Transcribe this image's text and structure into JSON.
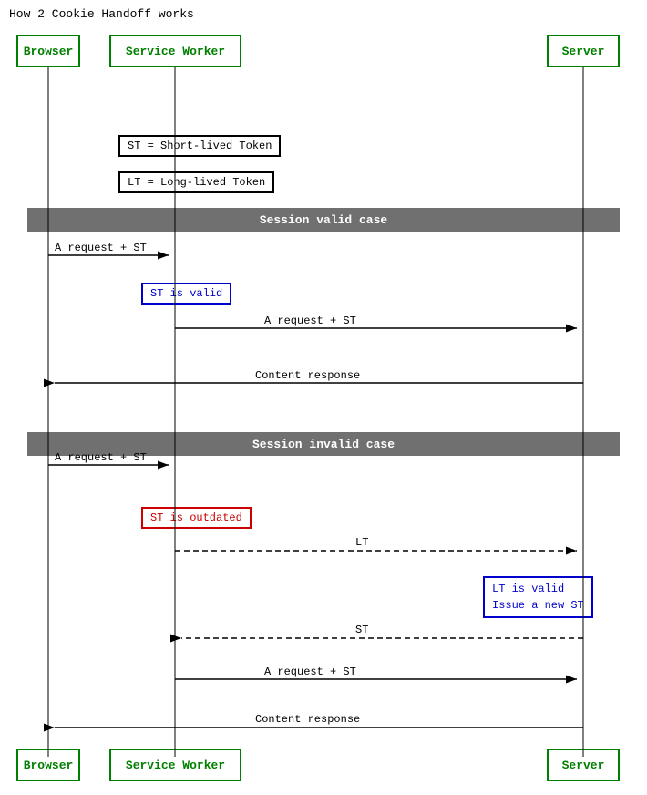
{
  "title": "How 2 Cookie Handoff works",
  "actors": {
    "browser": {
      "label": "Browser",
      "color": "green"
    },
    "serviceWorker": {
      "label": "Service Worker",
      "color": "green"
    },
    "server": {
      "label": "Server",
      "color": "green"
    }
  },
  "sections": {
    "valid": "Session valid case",
    "invalid": "Session invalid case"
  },
  "notes": {
    "st_def": "ST = Short-lived Token",
    "lt_def": "LT = Long-lived Token",
    "st_valid": "ST is valid",
    "st_outdated": "ST is outdated",
    "lt_valid_issue": "LT is valid\nIssue a new ST"
  },
  "messages": {
    "req_st_1": "A request + ST",
    "req_st_2": "A request + ST",
    "content_1": "Content response",
    "req_st_3": "A request + ST",
    "lt_msg": "LT",
    "st_msg": "ST",
    "req_st_4": "A request + ST",
    "content_2": "Content response"
  }
}
